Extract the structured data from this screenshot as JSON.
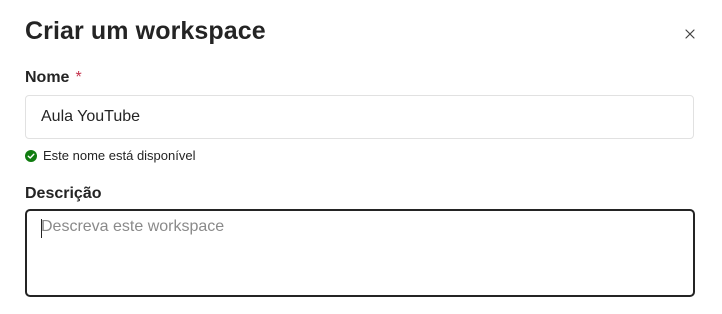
{
  "dialog": {
    "title": "Criar um workspace",
    "close_icon": "close-icon"
  },
  "name_field": {
    "label": "Nome",
    "required_mark": "*",
    "value": "Aula YouTube",
    "status_text": "Este nome está disponível",
    "status_icon": "check-circle-icon",
    "status_color": "#107c10"
  },
  "description_field": {
    "label": "Descrição",
    "value": "",
    "placeholder": "Descreva este workspace"
  }
}
